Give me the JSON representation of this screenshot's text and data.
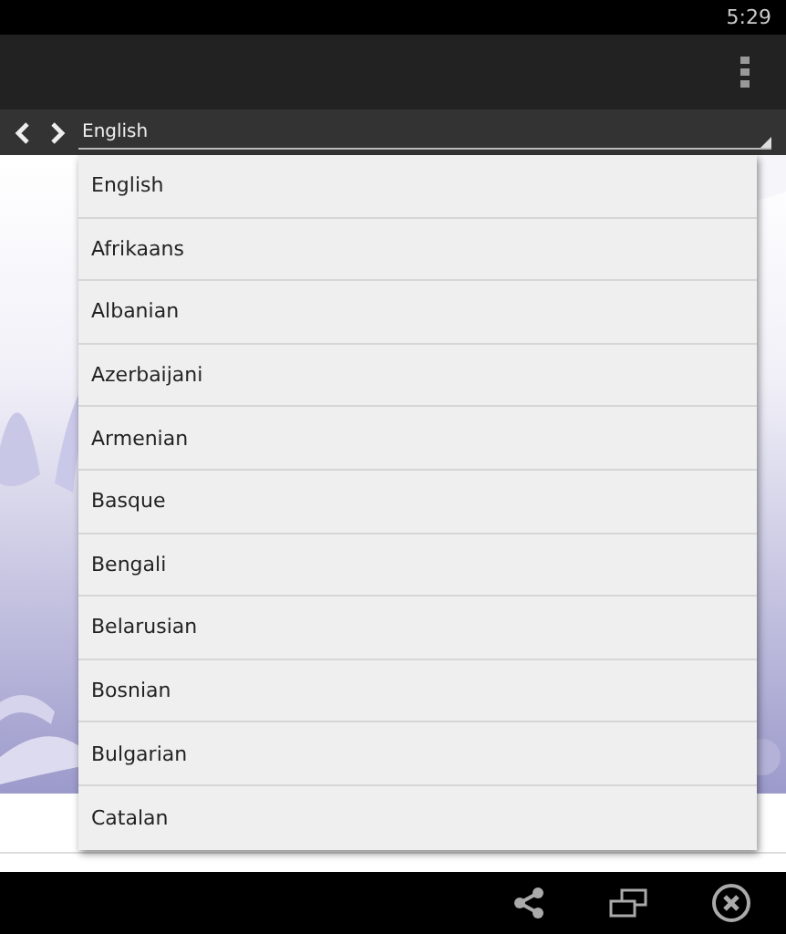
{
  "status_bar": {
    "time": "5:29"
  },
  "toolbar": {
    "language": "English"
  },
  "language_list": [
    "English",
    "Afrikaans",
    "Albanian",
    "Azerbaijani",
    "Armenian",
    "Basque",
    "Bengali",
    "Belarusian",
    "Bosnian",
    "Bulgarian",
    "Catalan"
  ]
}
